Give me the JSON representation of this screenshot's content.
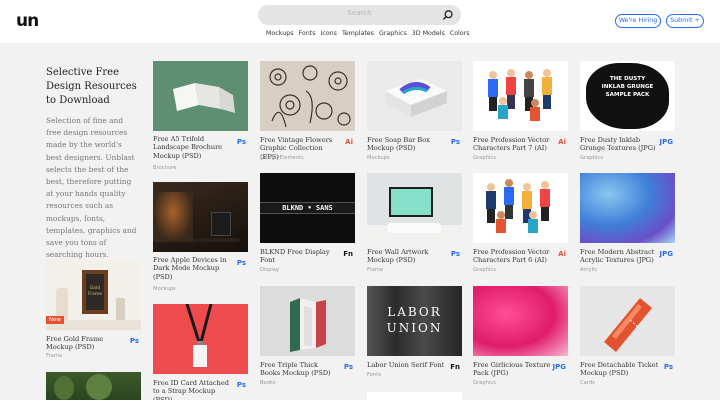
{
  "header": {
    "logo": "un",
    "search_placeholder": "Search",
    "categories": [
      "Mockups",
      "Fonts",
      "Icons",
      "Templates",
      "Graphics",
      "3D Models",
      "Colors"
    ],
    "hiring_label": "We're Hiring",
    "submit_label": "Submit +"
  },
  "intro": {
    "title": "Selective Free Design Resources to Download",
    "body": "Selection of fine and free design resources made by the world's best designers. Unblast selects the best of the best, therefore putting at your hands quality resources such as mockups, fonts, templates, graphics and save you tons of searching hours."
  },
  "colors": {
    "accent": "#2b6bf3",
    "ps": "#2b6bf3",
    "ai": "#e4532f",
    "fn": "#111111",
    "jpg": "#2b6bf3",
    "new": "#e4532f"
  },
  "cards": [
    {
      "title": "Free Gold Frame Mockup (PSD)",
      "category": "Frame",
      "badge": "Ps",
      "tag": "New",
      "thumb_icon": "gold-frame-thumbnail"
    },
    {
      "title": "",
      "category": "",
      "badge": "",
      "thumb_icon": "forest-thumbnail"
    },
    {
      "title": "Free A5 Trifold Landscape Brochure Mockup (PSD)",
      "category": "Brochure",
      "badge": "Ps",
      "thumb_icon": "trifold-brochure-thumbnail"
    },
    {
      "title": "Free Apple Devices in Dark Mode Mockup (PSD)",
      "category": "Mockups",
      "badge": "Ps",
      "thumb_icon": "apple-devices-thumbnail"
    },
    {
      "title": "Free ID Card Attached to a Strap Mockup (PSD)",
      "category": "",
      "badge": "Ps",
      "thumb_icon": "id-card-thumbnail"
    },
    {
      "title": "Free Vintage Flowers Graphic Collection (EPS)",
      "category": "Design Elements",
      "badge": "Ai",
      "thumb_icon": "vintage-flowers-thumbnail"
    },
    {
      "title": "BLKND Free Display Font",
      "category": "Display",
      "badge": "Fn",
      "thumb_icon": "blknd-font-thumbnail",
      "thumb_text": "BLKND • SANS"
    },
    {
      "title": "Free Triple Thick Books Mockup (PSD)",
      "category": "Books",
      "badge": "Ps",
      "thumb_icon": "books-thumbnail"
    },
    {
      "title": "Free Soap Bar Box Mockup (PSD)",
      "category": "Mockups",
      "badge": "Ps",
      "thumb_icon": "soap-box-thumbnail"
    },
    {
      "title": "Free Wall Artwork Mockup (PSD)",
      "category": "Frame",
      "badge": "Ps",
      "thumb_icon": "wall-artwork-thumbnail"
    },
    {
      "title": "Labor Union Serif Font",
      "category": "Fonts",
      "badge": "Fn",
      "thumb_icon": "labor-union-thumbnail",
      "thumb_text": "LABOR UNION"
    },
    {
      "title": "Free Profession Vector Characters Part 7 (AI)",
      "category": "Graphics",
      "badge": "Ai",
      "thumb_icon": "profession-characters-7-thumbnail"
    },
    {
      "title": "Free Profession Vector Characters Part 6 (AI)",
      "category": "Graphics",
      "badge": "Ai",
      "thumb_icon": "profession-characters-6-thumbnail"
    },
    {
      "title": "Free Girlicious Texture Pack (JPG)",
      "category": "Graphics",
      "badge": "JPG",
      "thumb_icon": "pink-texture-thumbnail"
    },
    {
      "title": "Free Dusty Inklab Grunge Textures (JPG)",
      "category": "Graphics",
      "badge": "JPG",
      "thumb_icon": "grunge-textures-thumbnail",
      "thumb_text": "THE DUSTY INKLAB GRUNGE SAMPLE PACK"
    },
    {
      "title": "Free Modern Abstract Acrylic Textures (JPG)",
      "category": "Acrylic",
      "badge": "JPG",
      "thumb_icon": "acrylic-textures-thumbnail"
    },
    {
      "title": "Free Detachable Ticket Mockup (PSD)",
      "category": "Cards",
      "badge": "Ps",
      "thumb_icon": "ticket-thumbnail"
    }
  ]
}
